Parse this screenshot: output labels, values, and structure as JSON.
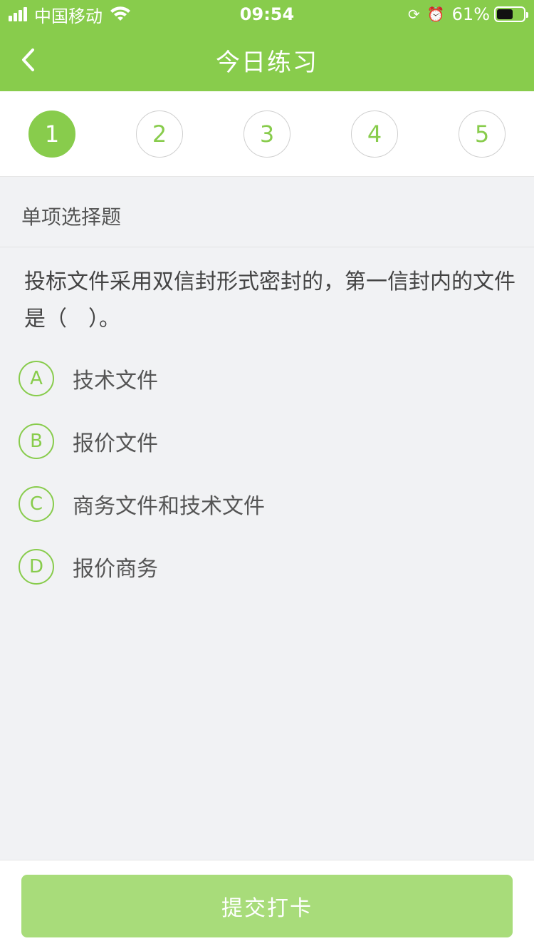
{
  "status_bar": {
    "carrier": "中国移动",
    "time": "09:54",
    "battery_percent": "61%",
    "battery_level": 0.61
  },
  "nav": {
    "title": "今日练习"
  },
  "steps": [
    {
      "label": "1",
      "active": true
    },
    {
      "label": "2",
      "active": false
    },
    {
      "label": "3",
      "active": false
    },
    {
      "label": "4",
      "active": false
    },
    {
      "label": "5",
      "active": false
    }
  ],
  "section": {
    "label": "单项选择题"
  },
  "question": {
    "text": "投标文件采用双信封形式密封的，第一信封内的文件是（　）。"
  },
  "options": [
    {
      "letter": "A",
      "text": "技术文件"
    },
    {
      "letter": "B",
      "text": "报价文件"
    },
    {
      "letter": "C",
      "text": "商务文件和技术文件"
    },
    {
      "letter": "D",
      "text": "报价商务"
    }
  ],
  "footer": {
    "submit_label": "提交打卡"
  },
  "colors": {
    "brand": "#88cc4c",
    "submit_disabled": "#a8dc7a"
  }
}
